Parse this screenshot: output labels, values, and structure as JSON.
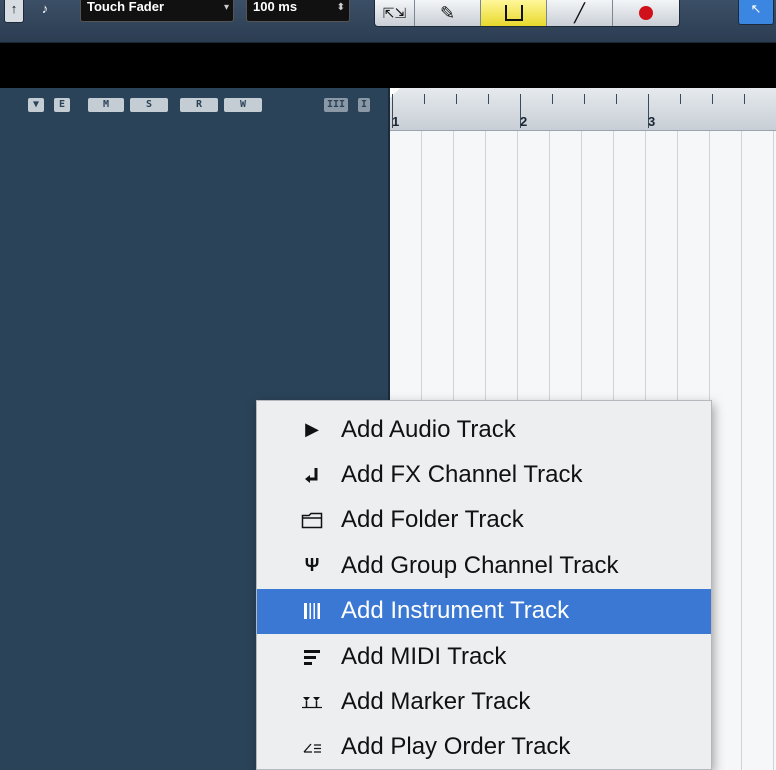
{
  "toolbar": {
    "automation_mode": "Touch Fader",
    "latency_value": "100 ms",
    "left_button_glyph": "↑",
    "note_glyph": "♪",
    "tools": [
      {
        "icon": "object-selection-icon",
        "glyph": "⇱⇲",
        "active": false
      },
      {
        "icon": "draw-tool-icon",
        "glyph": "✎",
        "active": false
      },
      {
        "icon": "erase-tool-icon",
        "glyph": "⌫",
        "active": true
      },
      {
        "icon": "pencil-tool-icon",
        "glyph": "╱",
        "active": false
      },
      {
        "icon": "record-icon",
        "glyph": "",
        "active": false
      }
    ],
    "right_tool_glyph": "↖"
  },
  "tracklist_header": {
    "buttons": [
      "▼",
      "E",
      "M",
      "S",
      "R",
      "W",
      "III",
      "I"
    ],
    "button_icons": [
      "collapse-icon",
      "edit-icon",
      "mute-icon",
      "solo-icon",
      "read-icon",
      "write-icon",
      "view-icon",
      "divider-icon"
    ]
  },
  "ruler": {
    "bars": [
      "1",
      "2",
      "3"
    ]
  },
  "menu": {
    "items": [
      {
        "label": "Add Audio Track",
        "icon": "audio-track-icon",
        "glyph": "▶",
        "selected": false
      },
      {
        "label": "Add FX Channel Track",
        "icon": "fx-channel-icon",
        "glyph": "⮐",
        "selected": false
      },
      {
        "label": "Add Folder Track",
        "icon": "folder-icon",
        "glyph": "🗀",
        "selected": false
      },
      {
        "label": "Add Group Channel Track",
        "icon": "group-channel-icon",
        "glyph": "Ψ",
        "selected": false
      },
      {
        "label": "Add Instrument Track",
        "icon": "instrument-icon",
        "glyph": "▥",
        "selected": true
      },
      {
        "label": "Add MIDI Track",
        "icon": "midi-track-icon",
        "glyph": "☰",
        "selected": false
      },
      {
        "label": "Add Marker Track",
        "icon": "marker-track-icon",
        "glyph": "⌶",
        "selected": false
      },
      {
        "label": "Add Play Order Track",
        "icon": "play-order-icon",
        "glyph": "∠",
        "selected": false
      }
    ]
  },
  "colors": {
    "selection": "#3b78d4",
    "tracklist_bg": "#2b4358",
    "record": "#d0101a"
  }
}
